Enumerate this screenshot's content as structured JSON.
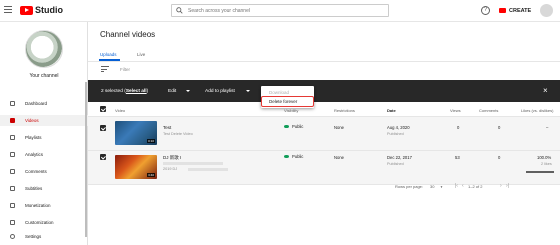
{
  "app": {
    "name": "Studio"
  },
  "search": {
    "placeholder": "Search across your channel"
  },
  "header": {
    "create_label": "CREATE",
    "help_symbol": "?"
  },
  "sidebar": {
    "channel_name": "Your channel",
    "channel_sub": "",
    "items": [
      {
        "label": "Dashboard"
      },
      {
        "label": "Videos"
      },
      {
        "label": "Playlists"
      },
      {
        "label": "Analytics"
      },
      {
        "label": "Comments"
      },
      {
        "label": "Subtitles"
      },
      {
        "label": "Monetization"
      },
      {
        "label": "Customization"
      }
    ],
    "settings_label": "Settings"
  },
  "page": {
    "title": "Channel videos"
  },
  "tabs": [
    {
      "label": "Uploads"
    },
    {
      "label": "Live"
    }
  ],
  "filter": {
    "label": "Filter"
  },
  "action_bar": {
    "selected_prefix": "2 selected (",
    "select_all": "Select all",
    "selected_suffix": ")",
    "edit": "Edit",
    "add_to_playlist": "Add to playlist",
    "close": "×"
  },
  "dropdown": {
    "download": "Download",
    "delete_forever": "Delete forever"
  },
  "table": {
    "columns": [
      "Video",
      "Visibility",
      "Restrictions",
      "Date",
      "Views",
      "Comments",
      "Likes (vs. dislikes)"
    ],
    "rows": [
      {
        "title": "Test",
        "description": "Test Delete Video",
        "duration": "0:10",
        "visibility": "Public",
        "restrictions": "None",
        "date": "Aug 4, 2020",
        "date_status": "Published",
        "views": "0",
        "comments": "0",
        "likes": "–",
        "likes_sub": ""
      },
      {
        "title": "DJ 新歌 I",
        "description": "2019 DJ",
        "duration": "3:40",
        "visibility": "Public",
        "restrictions": "None",
        "date": "Dec 22, 2017",
        "date_status": "Published",
        "views": "53",
        "comments": "0",
        "likes": "100.0%",
        "likes_sub": "2 likes"
      }
    ]
  },
  "pager": {
    "rows_label": "Rows per page:",
    "rows_value": "30",
    "range": "1–2 of 2"
  },
  "colors": {
    "accent": "#065fd4",
    "brand": "#ff0000",
    "action_bar": "#282828",
    "highlight": "#e53935"
  }
}
